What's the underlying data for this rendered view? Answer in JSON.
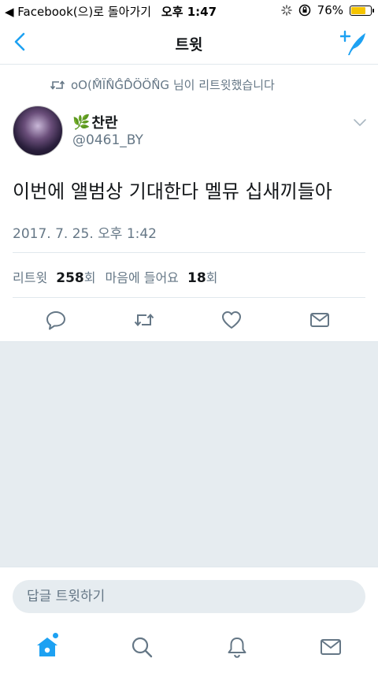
{
  "status_bar": {
    "back_app_label": "◀ Facebook(으)로 돌아가기",
    "time": "오후 1:47",
    "battery_percent": "76%",
    "battery_level": 0.76
  },
  "nav": {
    "title": "트윗",
    "back_icon": "chevron-left-icon",
    "compose_icon": "compose-tweet-icon"
  },
  "retweet_context": {
    "text": "oO(M̊ÏN̊G̊D̊ÖÖN̊G 님이 리트윗했습니다",
    "icon": "retweet-icon"
  },
  "tweet": {
    "author": {
      "name_emoji": "🌿",
      "name": "찬란",
      "handle": "@0461_BY"
    },
    "text": "이번에 앨범상 기대한다 멜뮤 십새끼들아",
    "timestamp": "2017. 7. 25. 오후 1:42",
    "stats": {
      "retweet_label": "리트윗",
      "retweet_count": "258",
      "retweet_unit": "회",
      "like_label": "마음에 들어요",
      "like_count": "18",
      "like_unit": "회"
    }
  },
  "reply": {
    "placeholder": "답글 트윗하기"
  },
  "colors": {
    "accent": "#1da1f2",
    "secondary_text": "#657786",
    "divider": "#e1e8ed",
    "background_gray": "#e6ecf0"
  }
}
